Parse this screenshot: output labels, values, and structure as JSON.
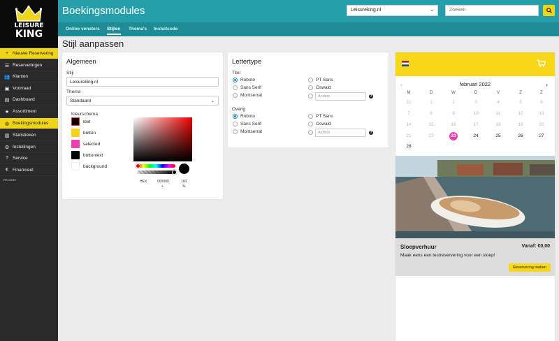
{
  "app": {
    "title": "Boekingsmodules",
    "logo_line1": "LEISURE",
    "logo_line2": "KING",
    "version": "VH14242"
  },
  "sidebar": {
    "items": [
      {
        "label": "Nieuwe Reservering",
        "icon": "plus-icon"
      },
      {
        "label": "Reserveringen",
        "icon": "list-icon"
      },
      {
        "label": "Klanten",
        "icon": "users-icon"
      },
      {
        "label": "Voorraad",
        "icon": "box-icon"
      },
      {
        "label": "Dashboard",
        "icon": "chart-icon"
      },
      {
        "label": "Assortiment",
        "icon": "star-icon"
      },
      {
        "label": "Boekingsmodules",
        "icon": "globe-icon"
      },
      {
        "label": "Statistieken",
        "icon": "stats-icon"
      },
      {
        "label": "Instellingen",
        "icon": "gear-icon"
      },
      {
        "label": "Service",
        "icon": "help-icon"
      },
      {
        "label": "Financieel",
        "icon": "euro-icon"
      }
    ]
  },
  "header": {
    "site_select": "Leisureking.nl",
    "search_placeholder": "Zoeken"
  },
  "tabs": [
    {
      "label": "Online vensters"
    },
    {
      "label": "Stijlen"
    },
    {
      "label": "Thema's"
    },
    {
      "label": "Insluitcode"
    }
  ],
  "page": {
    "title": "Stijl aanpassen"
  },
  "general": {
    "heading": "Algemeen",
    "style_label": "Stijl",
    "style_value": "Leisureking.nl",
    "theme_label": "Thema",
    "theme_value": "Standaard",
    "color_scheme_label": "Kleurschema",
    "colors": [
      {
        "name": "text",
        "hex": "#000000"
      },
      {
        "name": "button",
        "hex": "#f5d31c"
      },
      {
        "name": "selected",
        "hex": "#ee3fb0"
      },
      {
        "name": "buttontext",
        "hex": "#000000"
      },
      {
        "name": "background",
        "hex": "#ffffff"
      }
    ],
    "picker": {
      "hex_label": "HEX",
      "hex_value": "000000",
      "alpha_value": "100",
      "sign": "+",
      "pct": "%"
    }
  },
  "font": {
    "heading": "Lettertype",
    "title_label": "Titel",
    "other_label": "Overig",
    "options_left": [
      "Roboto",
      "Sans Serif",
      "Montserrat"
    ],
    "options_right": [
      "PT Sans",
      "Oswald"
    ],
    "other_placeholder": "Anders",
    "selected": "Roboto"
  },
  "preview": {
    "month": "februari 2022",
    "weekdays": [
      "M",
      "D",
      "W",
      "D",
      "V",
      "Z",
      "Z"
    ],
    "weeks": [
      [
        "31",
        "1",
        "2",
        "3",
        "4",
        "5",
        "6"
      ],
      [
        "7",
        "8",
        "9",
        "10",
        "11",
        "12",
        "13"
      ],
      [
        "14",
        "15",
        "16",
        "17",
        "18",
        "19",
        "20"
      ],
      [
        "21",
        "22",
        "23",
        "24",
        "25",
        "26",
        "27"
      ],
      [
        "28",
        "",
        "",
        "",
        "",
        "",
        ""
      ]
    ],
    "selected_day": "23",
    "product_name": "Sloepverhuur",
    "price": "Vanaf: €0,00",
    "description": "Maak eens een testreservering voor een sloep!",
    "button": "Reservering maken"
  }
}
